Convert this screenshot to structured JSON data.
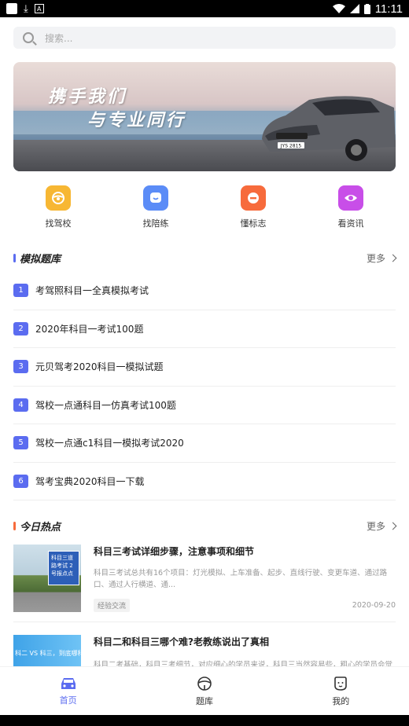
{
  "status_bar": {
    "time": "11:11"
  },
  "search": {
    "placeholder": "搜索..."
  },
  "banner": {
    "line1": "携手我们",
    "line2": "与专业同行",
    "plate": "JYS 2815"
  },
  "quick_links": [
    {
      "label": "找驾校",
      "icon": "steering-wheel-icon",
      "color": "#f7b733"
    },
    {
      "label": "找陪练",
      "icon": "chat-face-icon",
      "color": "#5b8cf7"
    },
    {
      "label": "懂标志",
      "icon": "no-entry-sign-icon",
      "color": "#f76b3c"
    },
    {
      "label": "看资讯",
      "icon": "eye-icon",
      "color": "#c84ee8"
    }
  ],
  "mock_exams": {
    "title": "模拟题库",
    "more": "更多",
    "accent": "#5b6cf0",
    "items": [
      {
        "num": "1",
        "text": "考驾照科目一全真模拟考试"
      },
      {
        "num": "2",
        "text": " 2020年科目一考试100题"
      },
      {
        "num": "3",
        "text": "元贝驾考2020科目一模拟试题"
      },
      {
        "num": "4",
        "text": "驾校一点通科目一仿真考试100题"
      },
      {
        "num": "5",
        "text": "驾校一点通c1科目一模拟考试2020"
      },
      {
        "num": "6",
        "text": "驾考宝典2020科目一下载"
      }
    ]
  },
  "hot_today": {
    "title": "今日热点",
    "more": "更多",
    "accent": "#f76b3c",
    "items": [
      {
        "title": "科目三考试详细步骤，注意事项和细节",
        "desc": "科目三考试总共有16个项目：灯光模拟、上车准备、起步、直线行驶、变更车道、通过路口、通过人行横道、通...",
        "tag": "经验交流",
        "date": "2020-09-20",
        "img_text": "科目三道路考试 2号报点点"
      },
      {
        "title": "科目二和科目三哪个难?老教练说出了真相",
        "desc": "科目二考基础，科目三考细节，对应细心的学员来说，科目三当然容易些，粗心的学员会觉",
        "img_text": "科二 VS 科三，到底哪科更难?"
      }
    ]
  },
  "tabs": [
    {
      "label": "首页",
      "icon": "car-icon",
      "active": true
    },
    {
      "label": "题库",
      "icon": "steering-wheel-icon",
      "active": false
    },
    {
      "label": "我的",
      "icon": "user-face-icon",
      "active": false
    }
  ]
}
